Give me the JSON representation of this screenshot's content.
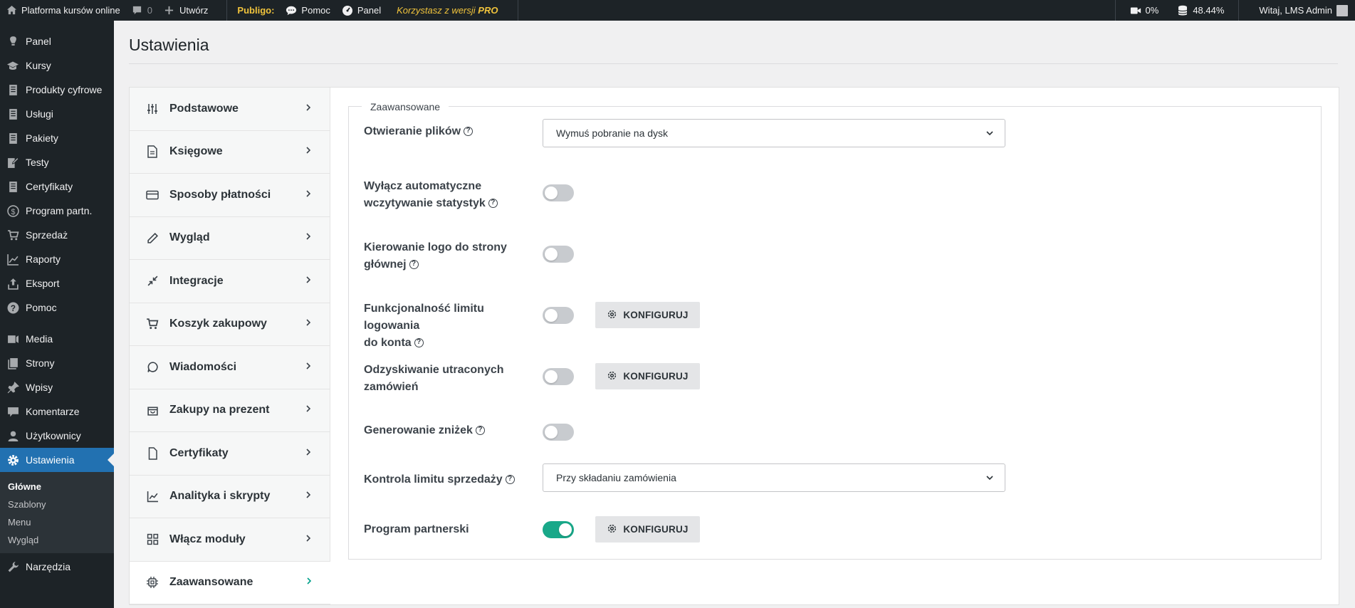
{
  "adminbar": {
    "site_name": "Platforma kursów online",
    "comments_count": "0",
    "new_label": "Utwórz",
    "publigo_label": "Publigo:",
    "help_label": "Pomoc",
    "panel_label": "Panel",
    "pro_text_prefix": "Korzystasz z wersji",
    "pro_text_strong": "PRO",
    "video_percent": "0%",
    "db_percent": "48.44%",
    "greeting": "Witaj, LMS Admin"
  },
  "sidebar": {
    "items": [
      {
        "label": "Panel",
        "icon": "gauge-icon"
      },
      {
        "label": "Kursy",
        "icon": "mortarboard-icon"
      },
      {
        "label": "Produkty cyfrowe",
        "icon": "document-icon"
      },
      {
        "label": "Usługi",
        "icon": "document-icon"
      },
      {
        "label": "Pakiety",
        "icon": "document-icon"
      },
      {
        "label": "Testy",
        "icon": "edit-page-icon"
      },
      {
        "label": "Certyfikaty",
        "icon": "document-icon"
      },
      {
        "label": "Program partn.",
        "icon": "dollar-icon"
      },
      {
        "label": "Sprzedaż",
        "icon": "cart-icon"
      },
      {
        "label": "Raporty",
        "icon": "chart-line-icon"
      },
      {
        "label": "Eksport",
        "icon": "upload-icon"
      },
      {
        "label": "Pomoc",
        "icon": "help-icon"
      }
    ],
    "items2": [
      {
        "label": "Media",
        "icon": "media-icon"
      },
      {
        "label": "Strony",
        "icon": "page-icon"
      },
      {
        "label": "Wpisy",
        "icon": "pin-icon"
      },
      {
        "label": "Komentarze",
        "icon": "comment-icon"
      },
      {
        "label": "Użytkownicy",
        "icon": "users-icon"
      },
      {
        "label": "Ustawienia",
        "icon": "gear-icon"
      }
    ],
    "submenu": [
      "Główne",
      "Szablony",
      "Menu",
      "Wygląd"
    ],
    "tools": {
      "label": "Narzędzia",
      "icon": "wrench-icon"
    }
  },
  "page": {
    "title": "Ustawienia"
  },
  "tabs": [
    {
      "label": "Podstawowe",
      "icon": "sliders-icon"
    },
    {
      "label": "Księgowe",
      "icon": "file-text-icon"
    },
    {
      "label": "Sposoby płatności",
      "icon": "credit-card-icon"
    },
    {
      "label": "Wygląd",
      "icon": "pencil-icon"
    },
    {
      "label": "Integracje",
      "icon": "shrink-arrows-icon"
    },
    {
      "label": "Koszyk zakupowy",
      "icon": "cart-icon"
    },
    {
      "label": "Wiadomości",
      "icon": "message-icon"
    },
    {
      "label": "Zakupy na prezent",
      "icon": "gift-bag-icon"
    },
    {
      "label": "Certyfikaty",
      "icon": "file-icon"
    },
    {
      "label": "Analityka i skrypty",
      "icon": "line-chart-icon"
    },
    {
      "label": "Włącz moduły",
      "icon": "grid-icon"
    },
    {
      "label": "Zaawansowane",
      "icon": "chip-icon"
    }
  ],
  "section": {
    "legend": "Zaawansowane",
    "file_opening": {
      "label": "Otwieranie plików",
      "value": "Wymuś pobranie na dysk"
    },
    "disable_stats": {
      "label_line1": "Wyłącz automatyczne",
      "label_line2": "wczytywanie statystyk",
      "on": false
    },
    "logo_link": {
      "label_line1": "Kierowanie logo do strony",
      "label_line2": "głównej",
      "on": false
    },
    "login_limit": {
      "label_line1": "Funkcjonalność limitu logowania",
      "label_line2": "do konta",
      "on": false
    },
    "abandoned_orders": {
      "label_line1": "Odzyskiwanie utraconych",
      "label_line2": "zamówień",
      "on": false
    },
    "discounts": {
      "label": "Generowanie zniżek",
      "on": false
    },
    "sales_limit": {
      "label": "Kontrola limitu sprzedaży",
      "value": "Przy składaniu zamówienia"
    },
    "partner_program": {
      "label": "Program partnerski",
      "on": true
    },
    "configure_label": "KONFIGURUJ"
  },
  "colors": {
    "accent_blue": "#2271b1",
    "toggle_on": "#19a889",
    "adminbar_bg": "#1d2327"
  }
}
